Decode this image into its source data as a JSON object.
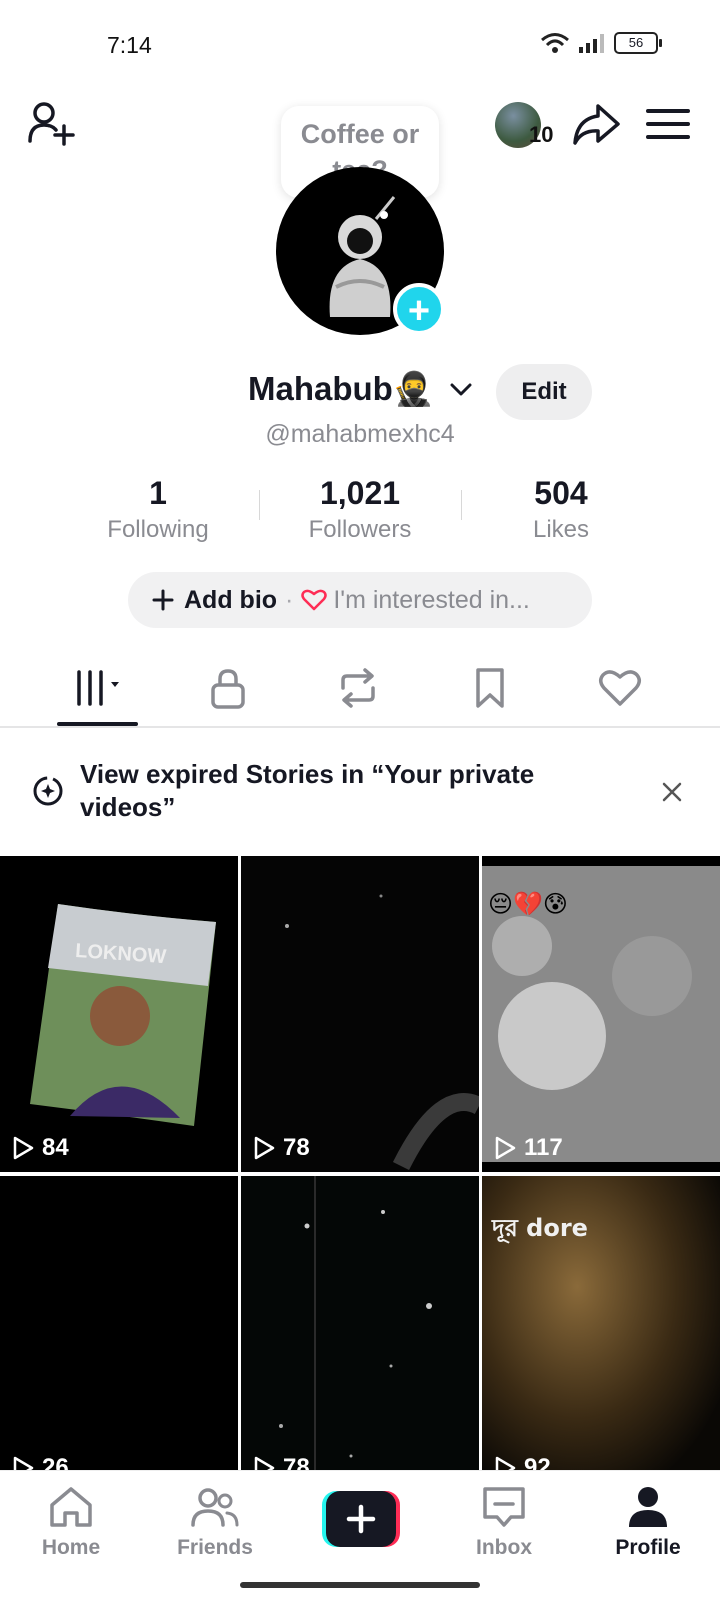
{
  "status_bar": {
    "time": "7:14",
    "battery": "56"
  },
  "header": {
    "story_prompt": "Coffee or tea?",
    "friends_count": "10"
  },
  "profile": {
    "name": "Mahabub🥷",
    "handle": "@mahabmexhc4",
    "edit_label": "Edit",
    "stats": [
      {
        "value": "1",
        "label": "Following"
      },
      {
        "value": "1,021",
        "label": "Followers"
      },
      {
        "value": "504",
        "label": "Likes"
      }
    ],
    "bio": {
      "add_label": "Add bio",
      "interest_label": "I'm interested in..."
    }
  },
  "banner": {
    "text": "View expired Stories in “Your private videos”"
  },
  "videos": [
    {
      "views": "84",
      "overlay": "LOKNOW"
    },
    {
      "views": "78"
    },
    {
      "views": "117",
      "overlay": "😔💔😰"
    },
    {
      "views": "26"
    },
    {
      "views": "78"
    },
    {
      "views": "92",
      "overlay": "দূর dore"
    }
  ],
  "nav": {
    "home": "Home",
    "friends": "Friends",
    "inbox": "Inbox",
    "profile": "Profile"
  }
}
